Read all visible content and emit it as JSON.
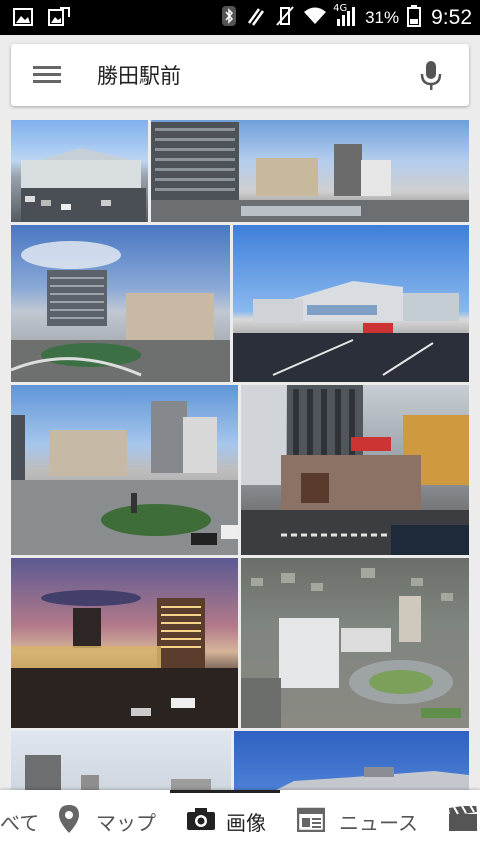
{
  "status": {
    "battery": "31%",
    "time": "9:52",
    "signal_label": "4G"
  },
  "search": {
    "query": "勝田駅前"
  },
  "tabs": [
    {
      "label": "べて",
      "icon": "all-icon"
    },
    {
      "label": "マップ",
      "icon": "map-pin-icon"
    },
    {
      "label": "画像",
      "icon": "camera-icon",
      "active": true
    },
    {
      "label": "ニュース",
      "icon": "news-icon"
    },
    {
      "label": "",
      "icon": "video-icon"
    }
  ],
  "images": [
    {
      "id": "station-plaza-photo"
    },
    {
      "id": "city-buildings-photo"
    },
    {
      "id": "rotary-buildings-photo"
    },
    {
      "id": "station-building-photo"
    },
    {
      "id": "plaza-towers-photo"
    },
    {
      "id": "street-corner-photo"
    },
    {
      "id": "night-station-photo"
    },
    {
      "id": "aerial-model-photo"
    },
    {
      "id": "tower-photo"
    },
    {
      "id": "station-blue-sky-photo"
    }
  ]
}
